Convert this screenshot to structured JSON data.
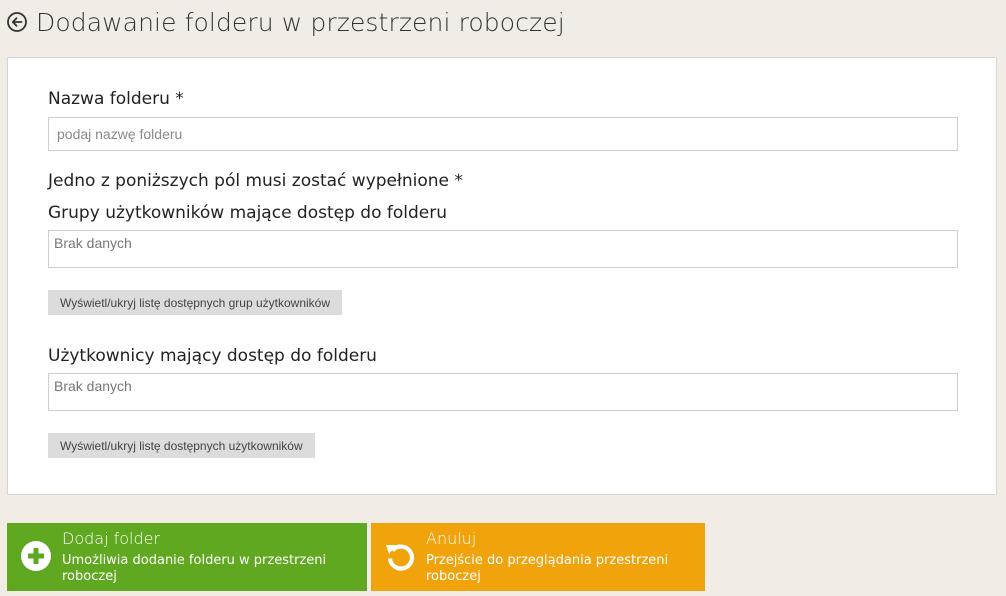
{
  "header": {
    "title": "Dodawanie folderu w przestrzeni roboczej",
    "back_icon": "arrow-left-circle-icon"
  },
  "form": {
    "folder_name_label": "Nazwa folderu *",
    "folder_name_placeholder": "podaj nazwę folderu",
    "folder_name_value": "",
    "required_notice": "Jedno z poniższych pól musi zostać wypełnione *",
    "groups_label": "Grupy użytkowników mające dostęp do folderu",
    "groups_value": "Brak danych",
    "groups_toggle_label": "Wyświetl/ukryj listę dostępnych grup użytkowników",
    "users_label": "Użytkownicy mający dostęp do folderu",
    "users_value": "Brak danych",
    "users_toggle_label": "Wyświetl/ukryj listę dostępnych użytkowników"
  },
  "actions": {
    "add": {
      "title": "Dodaj folder",
      "description": "Umożliwia dodanie folderu w przestrzeni roboczej",
      "icon": "plus-circle-icon",
      "color": "#5fa81f"
    },
    "cancel": {
      "title": "Anuluj",
      "description": "Przejście do przeglądania przestrzeni roboczej",
      "icon": "undo-icon",
      "color": "#f0a30b"
    }
  },
  "colors": {
    "background": "#f1ece6",
    "panel": "#ffffff",
    "button_gray": "#dcdcdc"
  }
}
